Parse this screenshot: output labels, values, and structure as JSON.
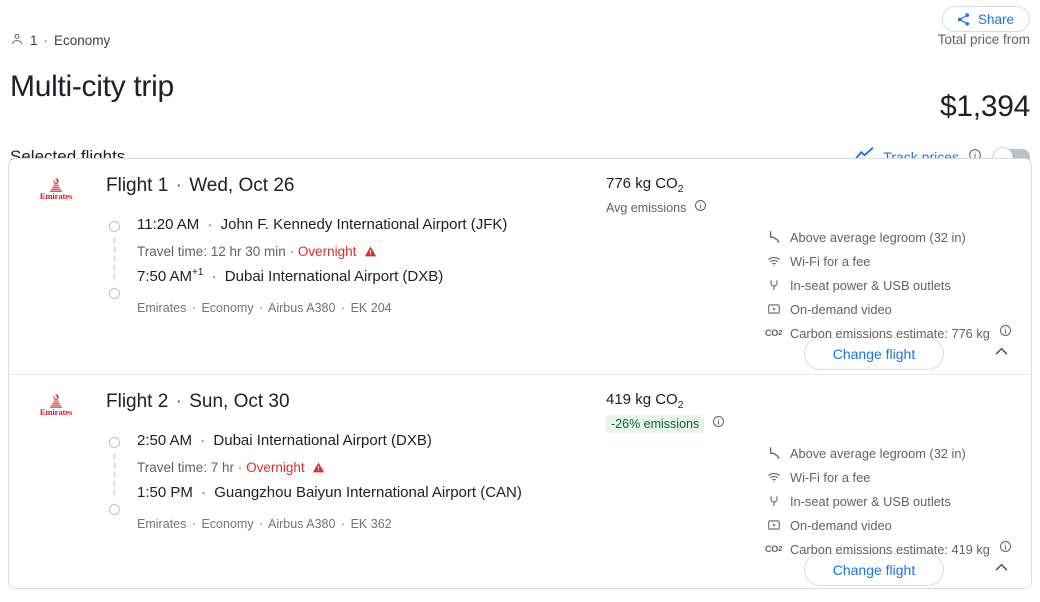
{
  "header": {
    "share_label": "Share",
    "share_icon": "share-icon",
    "passenger_icon": "person-icon",
    "passenger_count": "1",
    "separator": "·",
    "cabin_class": "Economy",
    "trip_title": "Multi-city trip",
    "total_price_label": "Total price from",
    "total_price": "$1,394",
    "selected_flights_label": "Selected flights",
    "track_prices_label": "Track prices",
    "track_prices_icon": "trending-up-icon",
    "track_prices_info_icon": "info-icon",
    "track_prices_toggle_state": "off"
  },
  "colors": {
    "accent_blue": "#1a73e8",
    "emirates_red": "#d71921",
    "warning_red": "#d93025",
    "green_badge_text": "#0d652d",
    "green_badge_bg": "#e6f4ea",
    "text_primary": "#202124",
    "text_secondary": "#5f6368",
    "border": "#dadce0"
  },
  "legs": [
    {
      "airline_logo": "emirates-logo",
      "airline_wordmark": "Emirates",
      "heading_flight": "Flight 1",
      "heading_sep": "·",
      "heading_date": "Wed, Oct 26",
      "depart_time": "11:20 AM",
      "depart_suffix": "",
      "depart_airport": "John F. Kennedy International Airport (JFK)",
      "travel_time_label": "Travel time: 12 hr 30 min",
      "travel_sep": "·",
      "overnight_label": "Overnight",
      "warning_icon": "warning-triangle-icon",
      "arrive_time": "7:50 AM",
      "arrive_suffix": "+1",
      "arrive_airport": "Dubai International Airport (DXB)",
      "operator": "Emirates",
      "cabin": "Economy",
      "aircraft": "Airbus A380",
      "flight_number": "EK 204",
      "emissions_value": "776 kg CO",
      "emissions_sub": "2",
      "emissions_note": "Avg emissions",
      "emissions_badge": "",
      "emissions_info_icon": "info-icon",
      "change_flight_label": "Change flight",
      "collapse_icon": "chevron-up-icon",
      "amenities": [
        {
          "icon": "legroom-icon",
          "label": "Above average legroom (32 in)"
        },
        {
          "icon": "wifi-icon",
          "label": "Wi-Fi for a fee"
        },
        {
          "icon": "power-outlet-icon",
          "label": "In-seat power & USB outlets"
        },
        {
          "icon": "on-demand-video-icon",
          "label": "On-demand video"
        },
        {
          "icon": "co2-icon",
          "label": "Carbon emissions estimate: 776 kg"
        }
      ]
    },
    {
      "airline_logo": "emirates-logo",
      "airline_wordmark": "Emirates",
      "heading_flight": "Flight 2",
      "heading_sep": "·",
      "heading_date": "Sun, Oct 30",
      "depart_time": "2:50 AM",
      "depart_suffix": "",
      "depart_airport": "Dubai International Airport (DXB)",
      "travel_time_label": "Travel time: 7 hr",
      "travel_sep": "·",
      "overnight_label": "Overnight",
      "warning_icon": "warning-triangle-icon",
      "arrive_time": "1:50 PM",
      "arrive_suffix": "",
      "arrive_airport": "Guangzhou Baiyun International Airport (CAN)",
      "operator": "Emirates",
      "cabin": "Economy",
      "aircraft": "Airbus A380",
      "flight_number": "EK 362",
      "emissions_value": "419 kg CO",
      "emissions_sub": "2",
      "emissions_note": "",
      "emissions_badge": "-26% emissions",
      "emissions_info_icon": "info-icon",
      "change_flight_label": "Change flight",
      "collapse_icon": "chevron-up-icon",
      "amenities": [
        {
          "icon": "legroom-icon",
          "label": "Above average legroom (32 in)"
        },
        {
          "icon": "wifi-icon",
          "label": "Wi-Fi for a fee"
        },
        {
          "icon": "power-outlet-icon",
          "label": "In-seat power & USB outlets"
        },
        {
          "icon": "on-demand-video-icon",
          "label": "On-demand video"
        },
        {
          "icon": "co2-icon",
          "label": "Carbon emissions estimate: 419 kg"
        }
      ]
    }
  ]
}
